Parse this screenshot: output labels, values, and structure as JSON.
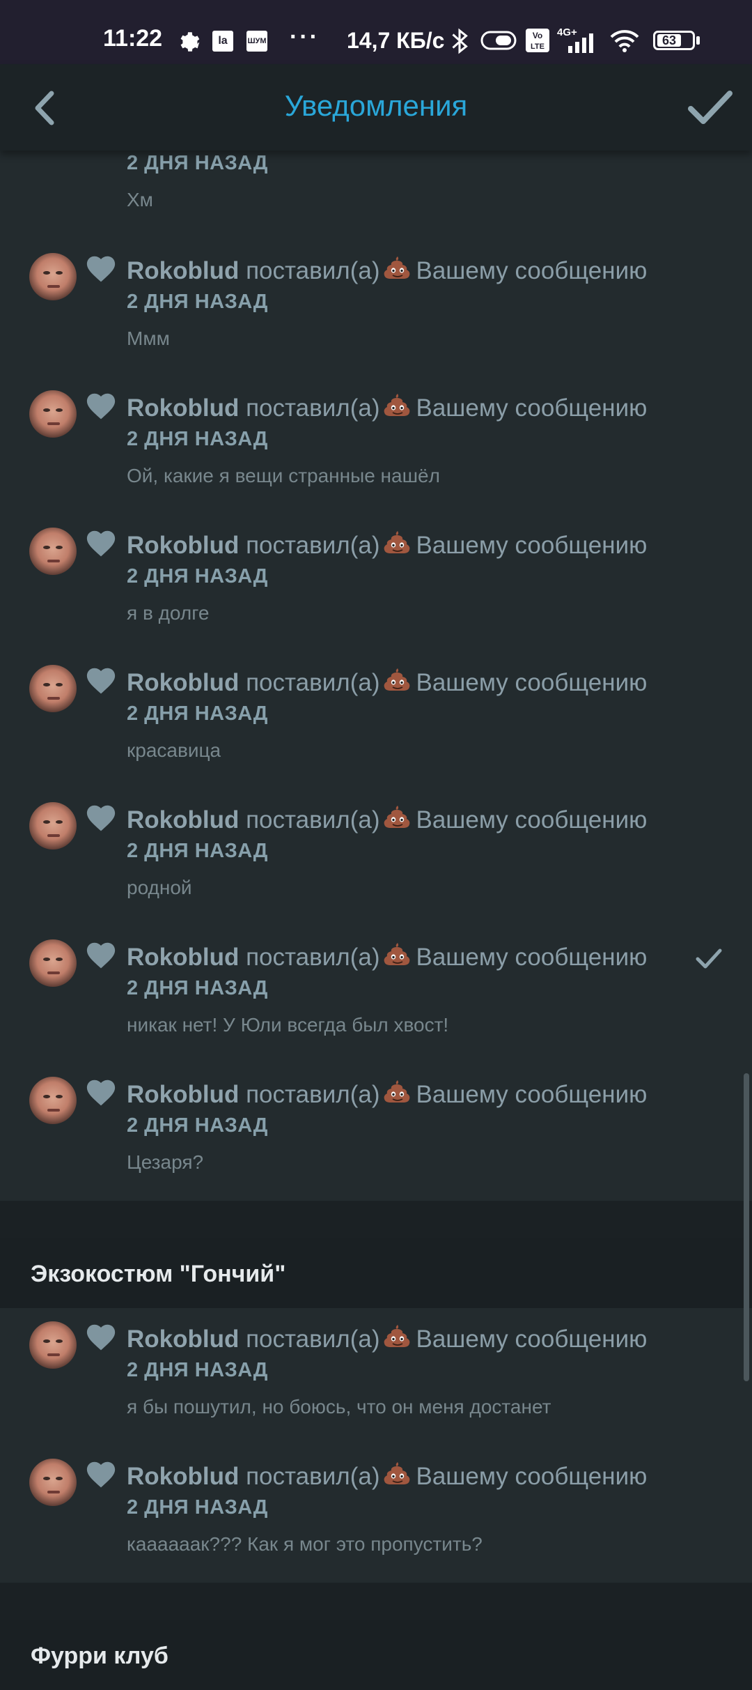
{
  "status_bar": {
    "time": "11:22",
    "icons": [
      "gear-icon",
      "la-app-icon",
      "app-icon",
      "more-icon"
    ],
    "more": "···",
    "net_speed": "14,7 КБ/с",
    "signal": "4G+",
    "battery": "63"
  },
  "header": {
    "title": "Уведомления",
    "back_icon": "chevron-left-icon",
    "mark_read_icon": "check-icon",
    "accent": "#2aa7d9"
  },
  "top_partial": {
    "time": "2 ДНЯ НАЗАД",
    "message": "Хм"
  },
  "groups": [
    {
      "items": [
        {
          "user": "Rokoblud",
          "action_pre": "поставил(а)",
          "action_post": "Вашему сообщению",
          "time": "2 ДНЯ НАЗАД",
          "message": "Ммм"
        },
        {
          "user": "Rokoblud",
          "action_pre": "поставил(а)",
          "action_post": "Вашему сообщению",
          "time": "2 ДНЯ НАЗАД",
          "message": "Ой, какие я вещи странные нашёл"
        },
        {
          "user": "Rokoblud",
          "action_pre": "поставил(а)",
          "action_post": "Вашему сообщению",
          "time": "2 ДНЯ НАЗАД",
          "message": "я в долге"
        },
        {
          "user": "Rokoblud",
          "action_pre": "поставил(а)",
          "action_post": "Вашему сообщению",
          "time": "2 ДНЯ НАЗАД",
          "message": "красавица"
        },
        {
          "user": "Rokoblud",
          "action_pre": "поставил(а)",
          "action_post": "Вашему сообщению",
          "time": "2 ДНЯ НАЗАД",
          "message": "родной"
        },
        {
          "user": "Rokoblud",
          "action_pre": "поставил(а)",
          "action_post": "Вашему сообщению",
          "time": "2 ДНЯ НАЗАД",
          "message": "никак нет! У Юли всегда был хвост!",
          "marked_read": true
        },
        {
          "user": "Rokoblud",
          "action_pre": "поставил(а)",
          "action_post": "Вашему сообщению",
          "time": "2 ДНЯ НАЗАД",
          "message": "Цезаря?"
        }
      ]
    },
    {
      "title": "Экзокостюм \"Гончий\"",
      "items": [
        {
          "user": "Rokoblud",
          "action_pre": "поставил(а)",
          "action_post": "Вашему сообщению",
          "time": "2 ДНЯ НАЗАД",
          "message": "я бы пошутил, но боюсь, что он меня достанет"
        },
        {
          "user": "Rokoblud",
          "action_pre": "поставил(а)",
          "action_post": "Вашему сообщению",
          "time": "2 ДНЯ НАЗАД",
          "message": "каааааак??? Как я мог это пропустить?"
        }
      ]
    },
    {
      "title": "Фурри клуб",
      "items": []
    }
  ],
  "reaction_icon": "poop-emoji-icon",
  "like_icon": "heart-icon"
}
